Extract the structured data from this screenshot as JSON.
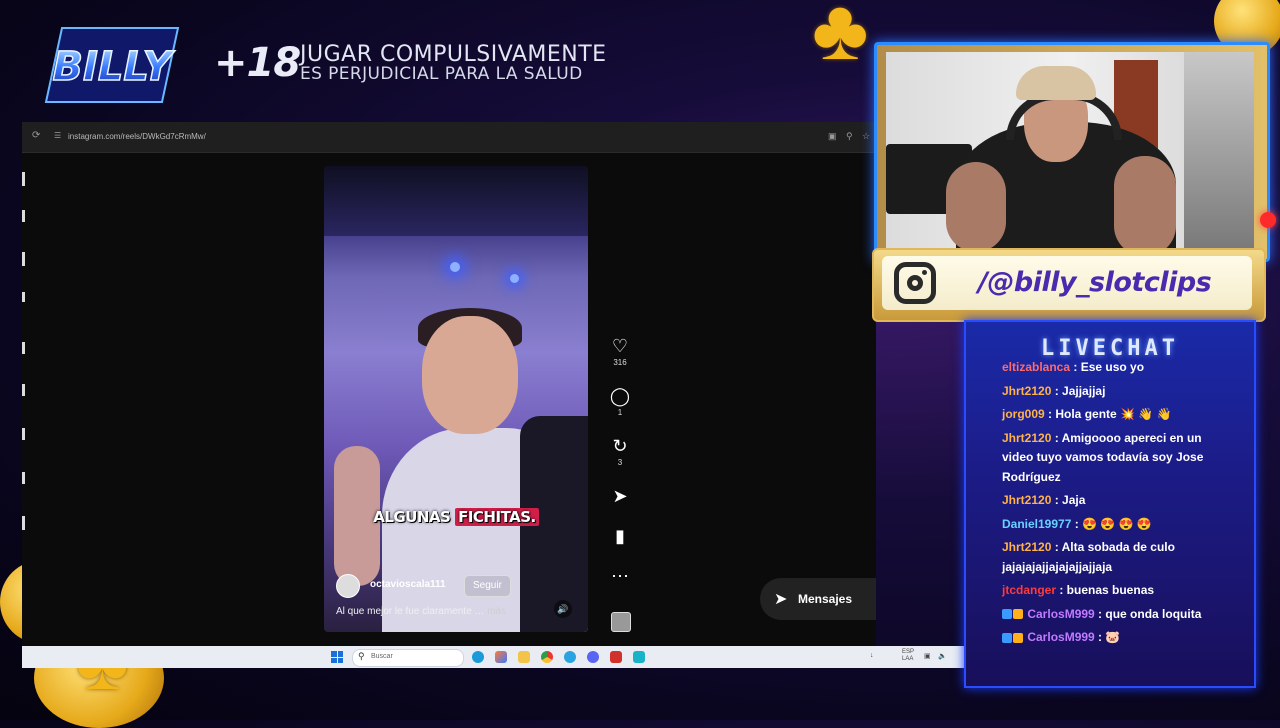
{
  "overlay": {
    "logo_text": "BILLY",
    "age_warning": "+18",
    "warning_line1": "JUGAR COMPULSIVAMENTE",
    "warning_line2": "ES PERJUDICIAL PARA LA SALUD",
    "instagram_handle": "/@billy_slotclips",
    "chip_text": "BILLY"
  },
  "browser": {
    "url": "instagram.com/reels/DWkGd7cRmMw/"
  },
  "reel": {
    "caption_part1": "ALGUNAS",
    "caption_part2": "FICHITAS.",
    "username": "octavioscala111",
    "follow_label": "Seguir",
    "description": "Al que mejor le fue claramente …",
    "more_label": "más",
    "likes": "316",
    "comments": "1",
    "reposts": "3"
  },
  "messages_label": "Mensajes",
  "taskbar": {
    "search_placeholder": "Buscar",
    "lang_top": "ESP",
    "lang_bottom": "LAA"
  },
  "chat": {
    "title": "LIVECHAT",
    "messages": [
      {
        "user": "eltizablanca",
        "text": ": Ese uso yo",
        "color": "#ff6a6a"
      },
      {
        "user": "Jhrt2120",
        "text": ": Jajjajjaj",
        "color": "#ffb24a"
      },
      {
        "user": "jorg009",
        "text": ": Hola gente 💥 👋 👋",
        "color": "#ffb24a"
      },
      {
        "user": "Jhrt2120",
        "text": ": Amigoooo apereci en un video tuyo vamos todavía soy Jose Rodríguez",
        "color": "#ffb24a"
      },
      {
        "user": "Jhrt2120",
        "text": ": Jaja",
        "color": "#ffb24a"
      },
      {
        "user": "Daniel19977",
        "text": ": 😍 😍 😍 😍",
        "color": "#6ad0ff"
      },
      {
        "user": "Jhrt2120",
        "text": ": Alta sobada de culo jajajajajjajajajjajjaja",
        "color": "#ffb24a"
      },
      {
        "user": "jtcdanger",
        "text": ": buenas buenas",
        "color": "#ff3a3a"
      },
      {
        "user": "CarlosM999",
        "text": ": que onda loquita",
        "color": "#c07aff"
      },
      {
        "user": "CarlosM999",
        "text": ": 🐷",
        "color": "#c07aff"
      }
    ]
  },
  "colors": {
    "accent_blue": "#2a8cff",
    "insta_handle": "#4a2bb0",
    "caption_highlight": "#d21f4a",
    "gold": "#f2b61a"
  }
}
